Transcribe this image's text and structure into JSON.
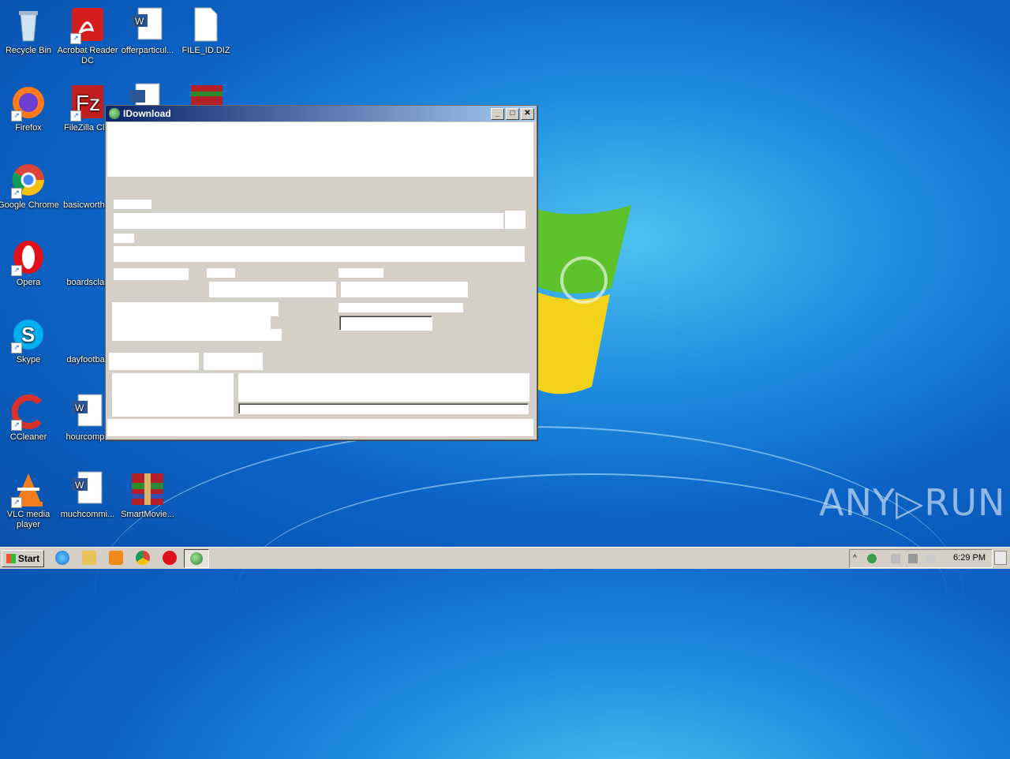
{
  "desktop_icons": [
    {
      "label": "Recycle Bin",
      "icon": "recycle-bin-icon"
    },
    {
      "label": "Acrobat Reader DC",
      "icon": "acrobat-icon"
    },
    {
      "label": "offerparticul...",
      "icon": "word-doc-icon"
    },
    {
      "label": "FILE_ID.DIZ",
      "icon": "blank-file-icon"
    },
    {
      "label": "Firefox",
      "icon": "firefox-icon"
    },
    {
      "label": "FileZilla Clie",
      "icon": "filezilla-icon"
    },
    {
      "label": "Google Chrome",
      "icon": "chrome-icon"
    },
    {
      "label": "basicworth...",
      "icon": "word-doc-icon"
    },
    {
      "label": "Opera",
      "icon": "opera-icon"
    },
    {
      "label": "boardsclas",
      "icon": "word-doc-icon"
    },
    {
      "label": "Skype",
      "icon": "skype-icon"
    },
    {
      "label": "dayfootball",
      "icon": "word-doc-icon"
    },
    {
      "label": "CCleaner",
      "icon": "ccleaner-icon"
    },
    {
      "label": "hourcompa",
      "icon": "word-doc-icon"
    },
    {
      "label": "VLC media player",
      "icon": "vlc-icon"
    },
    {
      "label": "muchcommi...",
      "icon": "word-doc-icon"
    },
    {
      "label": "SmartMovie...",
      "icon": "winrar-icon"
    }
  ],
  "window": {
    "title": "IDownload",
    "minimize": "_",
    "maximize": "□",
    "close": "✕"
  },
  "taskbar": {
    "start_label": "Start",
    "clock": "6:29 PM"
  },
  "watermark": "ANY▷RUN",
  "colors": {
    "desktop": "#0b63c6",
    "titlebar_start": "#0a246a",
    "titlebar_end": "#a6caf0",
    "window_face": "#d4d0c8"
  }
}
